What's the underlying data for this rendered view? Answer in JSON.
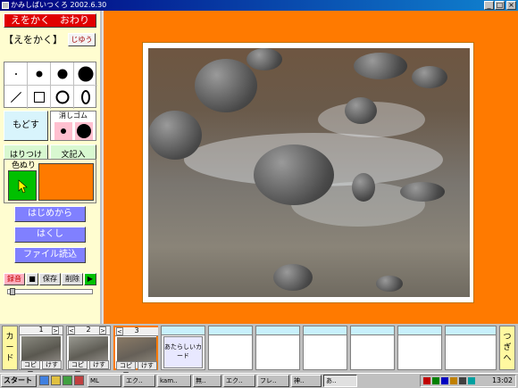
{
  "window": {
    "title": "かみしばいつくろ 2002.6.30",
    "min": "_",
    "max": "□",
    "close": "×"
  },
  "left": {
    "draw_end_button": "えをかく　おわり",
    "mode_label": "【えをかく】",
    "free_button": "じゆう",
    "undo_button": "もどす",
    "eraser_label": "消しゴム",
    "paste_button": "はりつけ",
    "text_button": "文記入",
    "color_label": "色ぬり",
    "restart_button": "はじめから",
    "delete_button": "はくし",
    "load_button": "ファイル読込",
    "sound": {
      "record": "録音",
      "stop": "■",
      "save": "保存",
      "erase": "削除",
      "play": "▶"
    }
  },
  "colors": {
    "canvas_bg": "#ff7a00",
    "accent_red": "#e00000",
    "nav_blue": "#8080ff",
    "panel_bg": "#fffdd0"
  },
  "cards": {
    "side_label": "カード",
    "next_label": "つぎへ",
    "items": [
      {
        "num": "1",
        "copy": "コピー",
        "erase": "けす"
      },
      {
        "num": "2",
        "copy": "コピー",
        "erase": "けす"
      },
      {
        "num": "3",
        "copy": "コピー",
        "erase": "けす"
      }
    ],
    "new_card": "あたらしいカード"
  },
  "taskbar": {
    "start": "スタート",
    "tasks": [
      "ML",
      "エク..",
      "kam..",
      "無..",
      "エク..",
      "フレ..",
      "神..",
      "あ.."
    ],
    "clock": "13:02"
  }
}
